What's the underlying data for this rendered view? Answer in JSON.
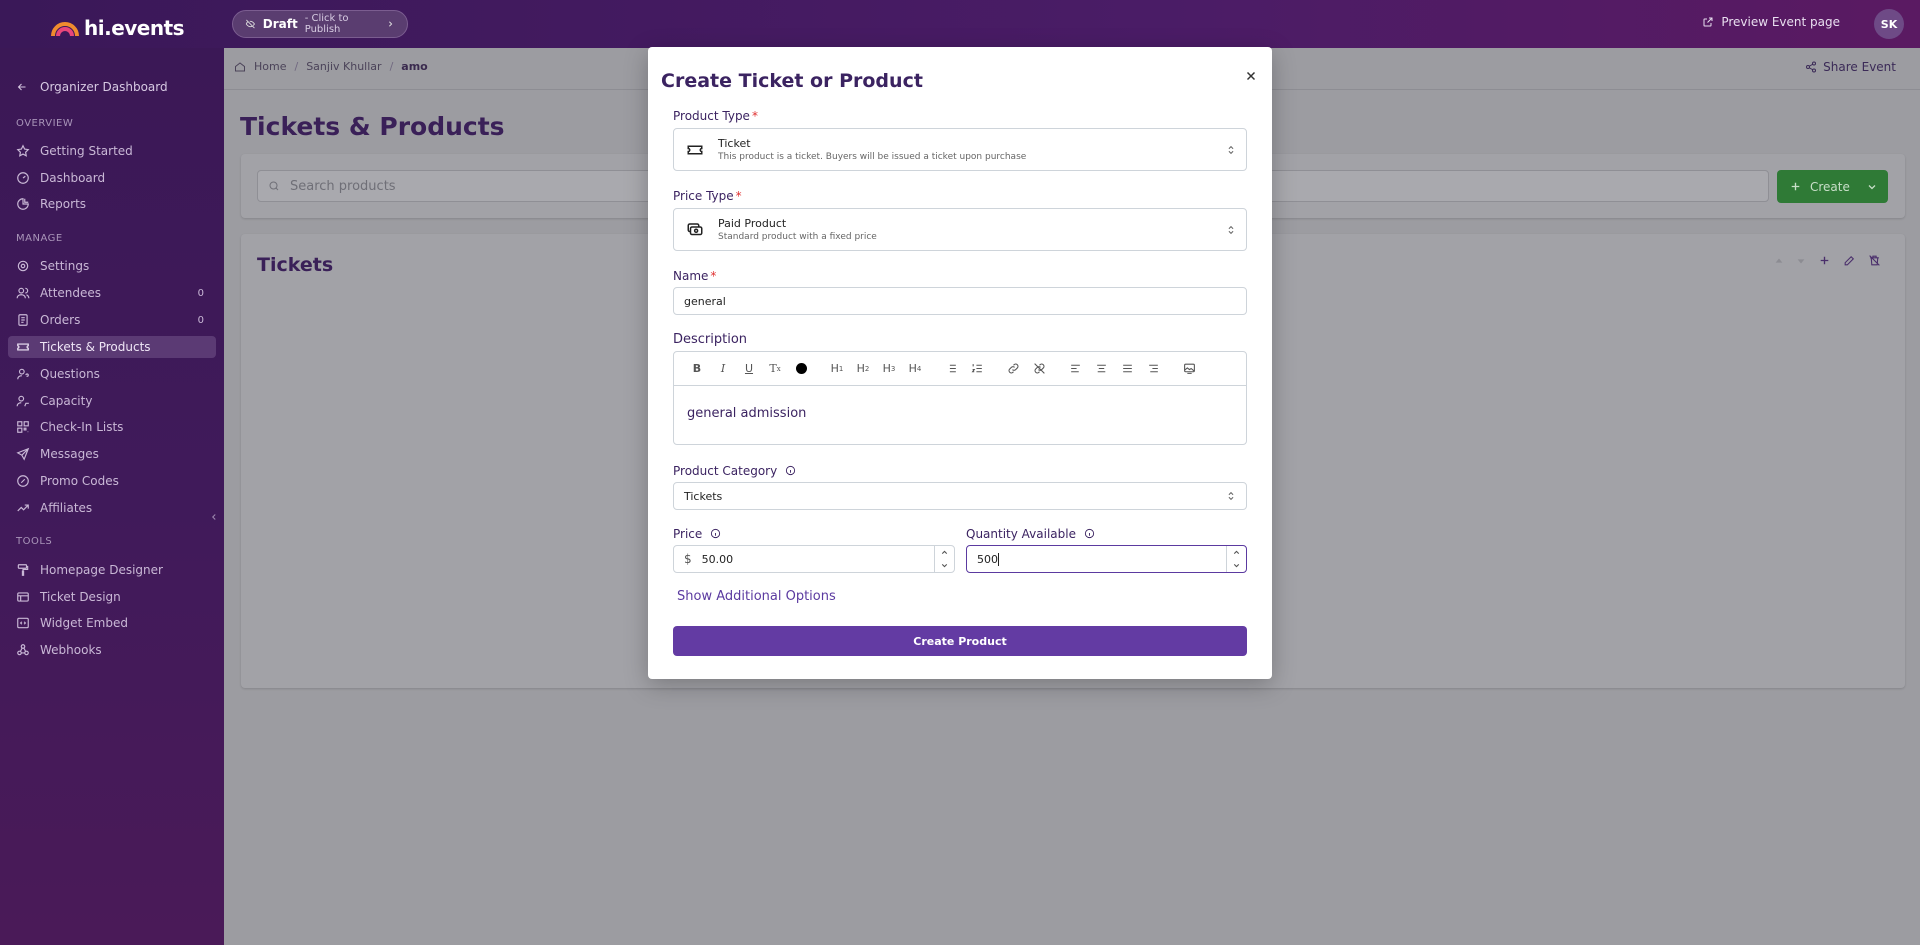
{
  "app": {
    "logo_text": "hi.events"
  },
  "topbar": {
    "draft_label": "Draft",
    "draft_hint": "- Click to Publish",
    "preview_label": "Preview Event page",
    "avatar_initials": "SK"
  },
  "sidebar": {
    "organizer_label": "Organizer Dashboard",
    "sections": {
      "overview": "OVERVIEW",
      "manage": "MANAGE",
      "tools": "TOOLS"
    },
    "overview_items": [
      {
        "label": "Getting Started",
        "icon": "star-icon"
      },
      {
        "label": "Dashboard",
        "icon": "dashboard-icon"
      },
      {
        "label": "Reports",
        "icon": "reports-icon"
      }
    ],
    "manage_items": [
      {
        "label": "Settings",
        "icon": "gear-icon"
      },
      {
        "label": "Attendees",
        "icon": "users-icon",
        "count": "0"
      },
      {
        "label": "Orders",
        "icon": "orders-icon",
        "count": "0"
      },
      {
        "label": "Tickets & Products",
        "icon": "ticket-icon",
        "active": true
      },
      {
        "label": "Questions",
        "icon": "questions-icon"
      },
      {
        "label": "Capacity",
        "icon": "capacity-icon"
      },
      {
        "label": "Check-In Lists",
        "icon": "checkin-icon"
      },
      {
        "label": "Messages",
        "icon": "send-icon"
      },
      {
        "label": "Promo Codes",
        "icon": "discount-icon"
      },
      {
        "label": "Affiliates",
        "icon": "trend-icon"
      }
    ],
    "tools_items": [
      {
        "label": "Homepage Designer",
        "icon": "paint-icon"
      },
      {
        "label": "Ticket Design",
        "icon": "ticket-design-icon"
      },
      {
        "label": "Widget Embed",
        "icon": "code-icon"
      },
      {
        "label": "Webhooks",
        "icon": "webhook-icon"
      }
    ]
  },
  "breadcrumb": {
    "home": "Home",
    "organizer": "Sanjiv Khullar",
    "event": "amo"
  },
  "header": {
    "share_label": "Share Event"
  },
  "page": {
    "title": "Tickets & Products",
    "search_placeholder": "Search products",
    "create_label": "Create",
    "tickets_title": "Tickets"
  },
  "modal": {
    "title": "Create Ticket or Product",
    "product_type": {
      "label": "Product Type",
      "value_title": "Ticket",
      "value_desc": "This product is a ticket. Buyers will be issued a ticket upon purchase"
    },
    "price_type": {
      "label": "Price Type",
      "value_title": "Paid Product",
      "value_desc": "Standard product with a fixed price"
    },
    "name": {
      "label": "Name",
      "value": "general"
    },
    "description": {
      "label": "Description",
      "value": "general admission",
      "toolbar": [
        "B",
        "I",
        "U",
        "Tx",
        "color",
        "H1",
        "H2",
        "H3",
        "H4"
      ]
    },
    "category": {
      "label": "Product Category",
      "value": "Tickets"
    },
    "price": {
      "label": "Price",
      "currency": "$",
      "value": "50.00"
    },
    "quantity": {
      "label": "Quantity Available",
      "value": "500"
    },
    "more_options": "Show Additional Options",
    "submit": "Create Product"
  },
  "colors": {
    "brand_purple": "#633ba3",
    "create_green": "#2f7a36",
    "required": "#e03131"
  }
}
